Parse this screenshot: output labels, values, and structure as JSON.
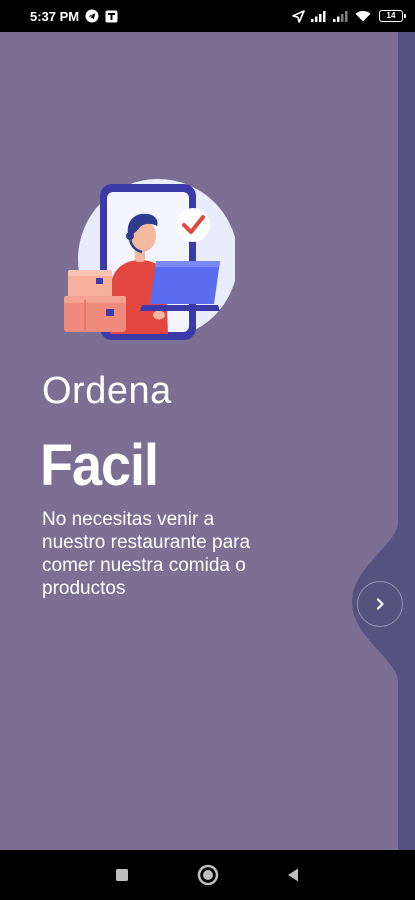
{
  "status_bar": {
    "time": "5:37 PM",
    "battery_level": "14",
    "left_icons": [
      "telegram-icon",
      "notification-app-icon"
    ],
    "right_icons": [
      "location-arrow-icon",
      "signal-icon",
      "signal-icon",
      "wifi-icon",
      "battery-icon"
    ]
  },
  "onboarding": {
    "headline_light": "Ordena",
    "headline_bold": "Facil",
    "description": "No necesitas venir a nuestro restaurante para comer nuestra comida o productos",
    "next_icon": "chevron-right-icon"
  },
  "navigation_bar": {
    "buttons": [
      "recents-square-icon",
      "home-circle-icon",
      "back-triangle-icon"
    ]
  },
  "colors": {
    "background": "#7b6f94",
    "side_strip": "#56527f",
    "illustration_circle": "#e9ecfa",
    "phone_frame": "#3b3aa8",
    "screen_blue": "#5b6cf0",
    "accent_red": "#e2463f",
    "box_coral": "#f08a7c"
  }
}
